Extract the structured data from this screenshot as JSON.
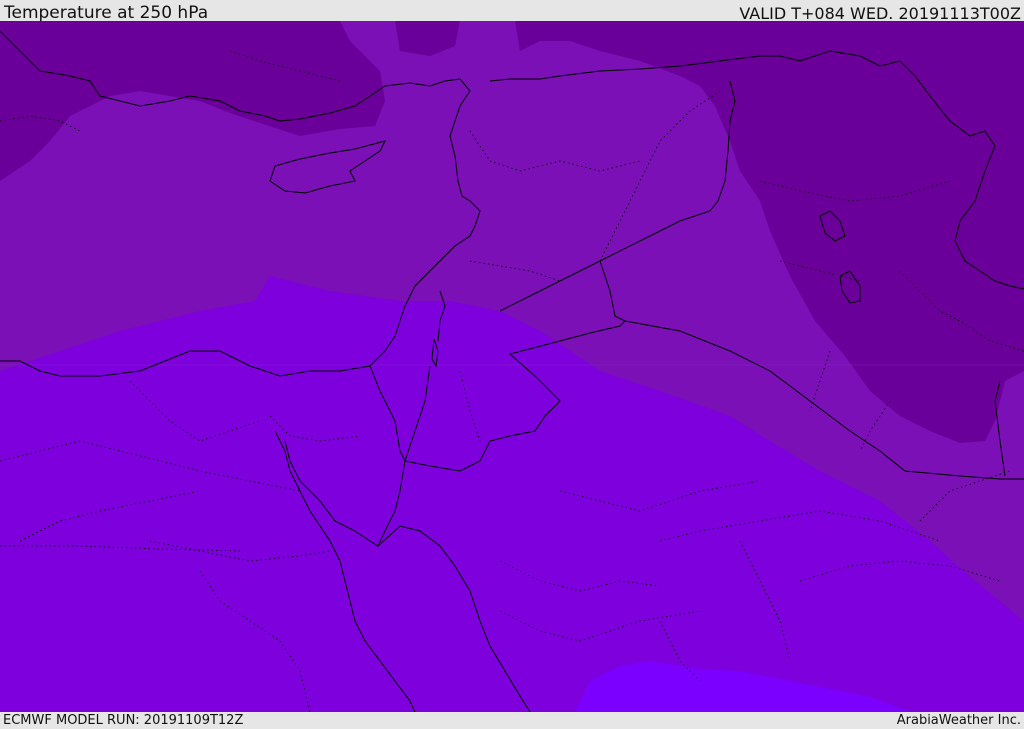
{
  "header": {
    "title": "Temperature at 250 hPa",
    "valid_time": "VALID T+084 WED. 20191113T00Z"
  },
  "footer": {
    "model_run": "ECMWF MODEL RUN: 20191109T12Z",
    "credit": "ArabiaWeather Inc."
  },
  "map": {
    "colors": {
      "warmest_band": "#7b00ff",
      "warm_band": "#7d00dd",
      "mid_band": "#7a10b6",
      "cold_band": "#6a0099",
      "border_line": "#000000"
    },
    "layers": [
      "temperature-shading",
      "coastlines",
      "country-borders",
      "province-borders"
    ]
  }
}
